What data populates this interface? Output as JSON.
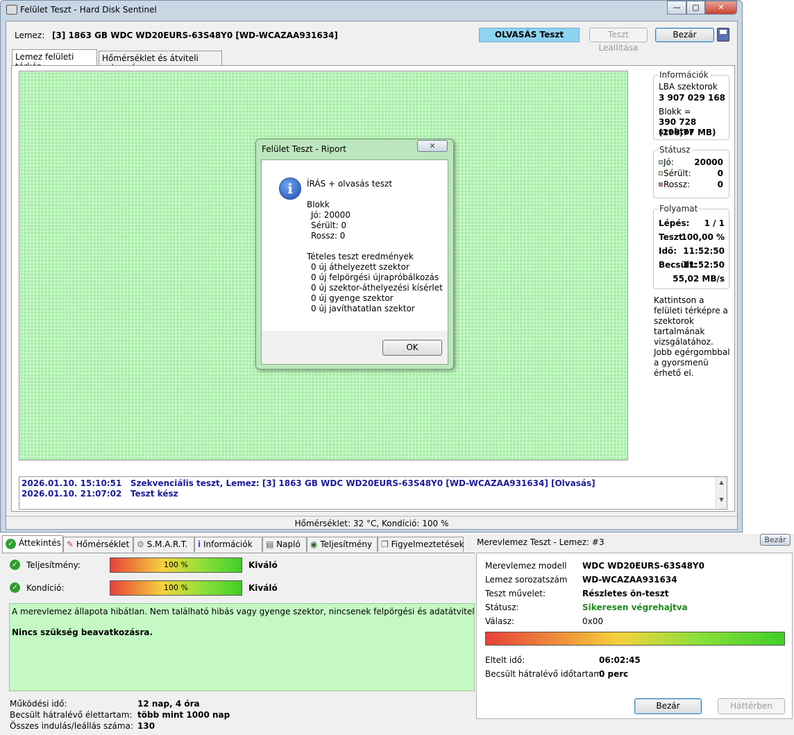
{
  "window": {
    "title": "Felület Teszt - Hard Disk Sentinel",
    "min": "—",
    "max": "▢",
    "close": "✕"
  },
  "toolbar": {
    "disk_label": "Lemez:",
    "disk_value": "[3] 1863 GB  WDC WD20EURS-63S48Y0 [WD-WCAZAA931634]",
    "mode": "OLVASÁS Teszt",
    "stop": "Teszt Leállítása",
    "close": "Bezár"
  },
  "tabs": {
    "map": "Lemez felületi térkép",
    "temp": "Hőmérséklet és átviteli sebesség"
  },
  "info": {
    "legend": "Információk",
    "lba_label": "LBA szektorok",
    "lba_value": "3 907 029 168",
    "block_label": "Blokk =",
    "block_value": "390 728 szektor",
    "block_mb": "(190,77 MB)"
  },
  "status": {
    "legend": "Státusz",
    "good_label": "Jó:",
    "good": "20000",
    "damaged_label": "Sérült:",
    "damaged": "0",
    "bad_label": "Rossz:",
    "bad": "0",
    "colors": {
      "good": "#9be89b",
      "damaged": "#e8e89b",
      "bad": "#e87a7a"
    }
  },
  "progress": {
    "legend": "Folyamat",
    "step_label": "Lépés:",
    "step": "1 / 1",
    "test_label": "Teszt:",
    "test": "100,00 %",
    "time_label": "Idő:",
    "time": "11:52:50",
    "est_label": "Becsült:",
    "est": "11:52:50",
    "speed": "55,02 MB/s"
  },
  "hints": {
    "click": "Kattintson a felületi térképre a szektorok tartalmának vizsgálatához.",
    "right": "Jobb egérgombbal a gyorsmenü érhető el."
  },
  "log": [
    {
      "date": "2026.01.10.  15:10:51",
      "text": "Szekvenciális teszt, Lemez: [3] 1863 GB  WDC WD20EURS-63S48Y0 [WD-WCAZAA931634] [Olvasás]"
    },
    {
      "date": "2026.01.10.  21:07:02",
      "text": "Teszt kész"
    }
  ],
  "statusbar": "Hőmérséklet: 32  °C,  Kondíció: 100 %",
  "report": {
    "title": "Felület Teszt - Riport",
    "close": "✕",
    "heading": "ÍRÁS + olvasás teszt",
    "block": "Blokk",
    "good": "Jó: 20000",
    "damaged": "Sérült: 0",
    "bad": "Rossz: 0",
    "results_title": "Tételes teszt eredmények",
    "results": [
      "0 új áthelyezett szektor",
      "0 új felpörgési újrapróbálkozás",
      "0 új szektor-áthelyezési kísérlet",
      "0 új gyenge szektor",
      "0 új javíthatatlan szektor"
    ],
    "ok": "OK"
  },
  "bottom": {
    "tabs": [
      "Áttekintés",
      "Hőmérséklet",
      "S.M.A.R.T.",
      "Információk",
      "Napló",
      "Teljesítmény",
      "Figyelmeztetések"
    ],
    "perf_label": "Teljesítmény:",
    "perf_value": "100 %",
    "perf_fill": 1.0,
    "perf_rating": "Kiváló",
    "cond_label": "Kondíció:",
    "cond_value": "100 %",
    "cond_fill": 1.0,
    "cond_rating": "Kiváló",
    "message": "A merevlemez állapota hibátlan. Nem található hibás vagy gyenge szektor, nincsenek felpörgési és adatátviteli hibák sem.",
    "advice": "Nincs szükség beavatkozásra.",
    "uptime_label": "Működési idő:",
    "uptime": "12 nap, 4 óra",
    "life_label": "Becsült hátralévő élettartam:",
    "life": "több mint 1000 nap",
    "starts_label": "Összes indulás/leállás száma:",
    "starts": "130"
  },
  "disktest": {
    "title": "Merevlemez Teszt - Lemez: #3",
    "close": "Bezár",
    "model_label": "Merevlemez modell",
    "model": "WDC WD20EURS-63S48Y0",
    "serial_label": "Lemez sorozatszám",
    "serial": "WD-WCAZAA931634",
    "op_label": "Teszt művelet:",
    "op": "Részletes ön-teszt",
    "status_label": "Státusz:",
    "status": "Sikeresen végrehajtva",
    "answer_label": "Válasz:",
    "answer": "0x00",
    "progress_fill": 1.0,
    "elapsed_label": "Eltelt idő:",
    "elapsed": "06:02:45",
    "remaining_label": "Becsült hátralévő időtartam:",
    "remaining": "0 perc",
    "background": "Háttérben"
  }
}
